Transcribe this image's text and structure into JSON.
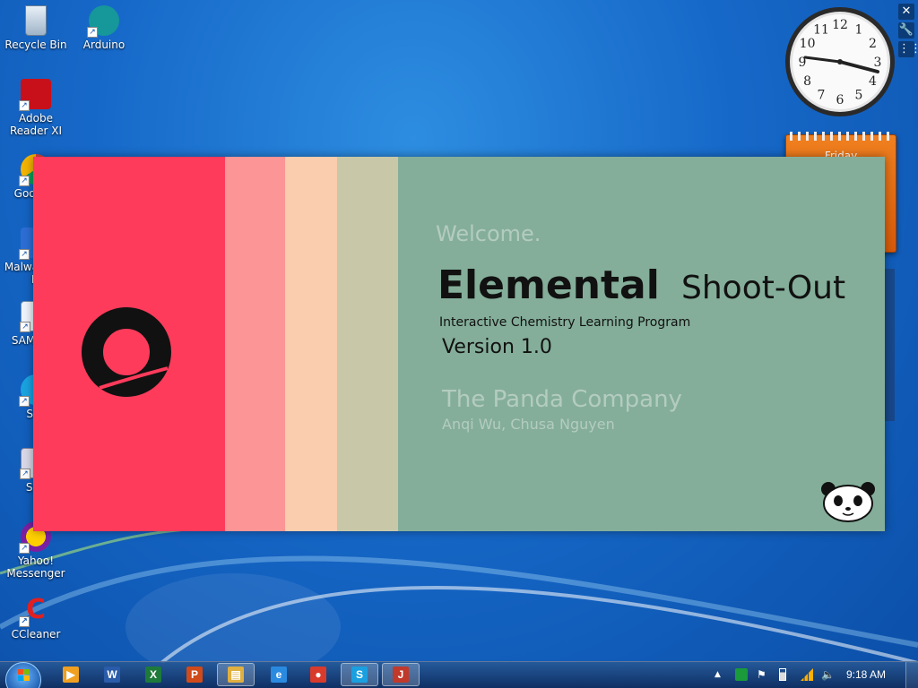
{
  "desktop": {
    "icons": [
      {
        "label": "Recycle Bin"
      },
      {
        "label": "Arduino"
      },
      {
        "label": "Adobe Reader XI"
      },
      {
        "label": "Goo Chr"
      },
      {
        "label": "Malwa Anti-M"
      },
      {
        "label": "SAM Dr.P"
      },
      {
        "label": "Sky"
      },
      {
        "label": "Syn"
      },
      {
        "label": "Yahoo! Messenger"
      },
      {
        "label": "CCleaner"
      }
    ]
  },
  "gadgets": {
    "calendar_day": "Friday",
    "clock_numbers": [
      "12",
      "1",
      "2",
      "3",
      "4",
      "5",
      "6",
      "7",
      "8",
      "9",
      "10",
      "11"
    ]
  },
  "splash": {
    "welcome": "Welcome.",
    "title_bold": "Elemental",
    "title_rest": "Shoot-Out",
    "subtitle": "Interactive Chemistry Learning Program",
    "version": "Version 1.0",
    "company": "The Panda Company",
    "authors": "Anqi Wu, Chusa Nguyen"
  },
  "taskbar": {
    "time": "9:18 AM",
    "apps": [
      {
        "name": "Media Player",
        "glyph": "▶",
        "color": "#f0a020"
      },
      {
        "name": "Word",
        "glyph": "W",
        "color": "#2a5caa"
      },
      {
        "name": "Excel",
        "glyph": "X",
        "color": "#1d7a3a"
      },
      {
        "name": "PowerPoint",
        "glyph": "P",
        "color": "#d04a1a"
      },
      {
        "name": "Explorer",
        "glyph": "▤",
        "color": "#e0b040"
      },
      {
        "name": "Internet Explorer",
        "glyph": "e",
        "color": "#2a8ae0"
      },
      {
        "name": "Chrome",
        "glyph": "●",
        "color": "#d83b2b"
      },
      {
        "name": "Skype",
        "glyph": "S",
        "color": "#1aa0e0"
      },
      {
        "name": "Java",
        "glyph": "J",
        "color": "#c0392b"
      }
    ]
  },
  "colors": {
    "stripe1": "#fe3b5b",
    "stripe2": "#fc9595",
    "stripe3": "#f9cdad",
    "stripe4": "#c8c8a8",
    "panel": "#84ae9a"
  }
}
